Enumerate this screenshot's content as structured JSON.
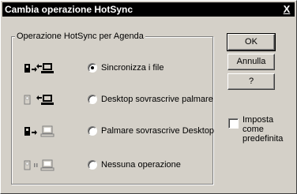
{
  "window": {
    "title": "Cambia operazione HotSync",
    "close_glyph": "X"
  },
  "group": {
    "label": "Operazione HotSync per Agenda"
  },
  "options": [
    {
      "label": "Sincronizza i file",
      "selected": true,
      "icon": "sync-both-icon"
    },
    {
      "label": "Desktop sovrascrive palmare",
      "selected": false,
      "icon": "desktop-overwrites-handheld-icon"
    },
    {
      "label": "Palmare sovrascrive Desktop",
      "selected": false,
      "icon": "handheld-overwrites-desktop-icon"
    },
    {
      "label": "Nessuna operazione",
      "selected": false,
      "icon": "do-nothing-icon"
    }
  ],
  "buttons": {
    "ok": "OK",
    "cancel": "Annulla",
    "help": "?"
  },
  "default_checkbox": {
    "label": "Imposta come predefinita",
    "checked": false
  }
}
